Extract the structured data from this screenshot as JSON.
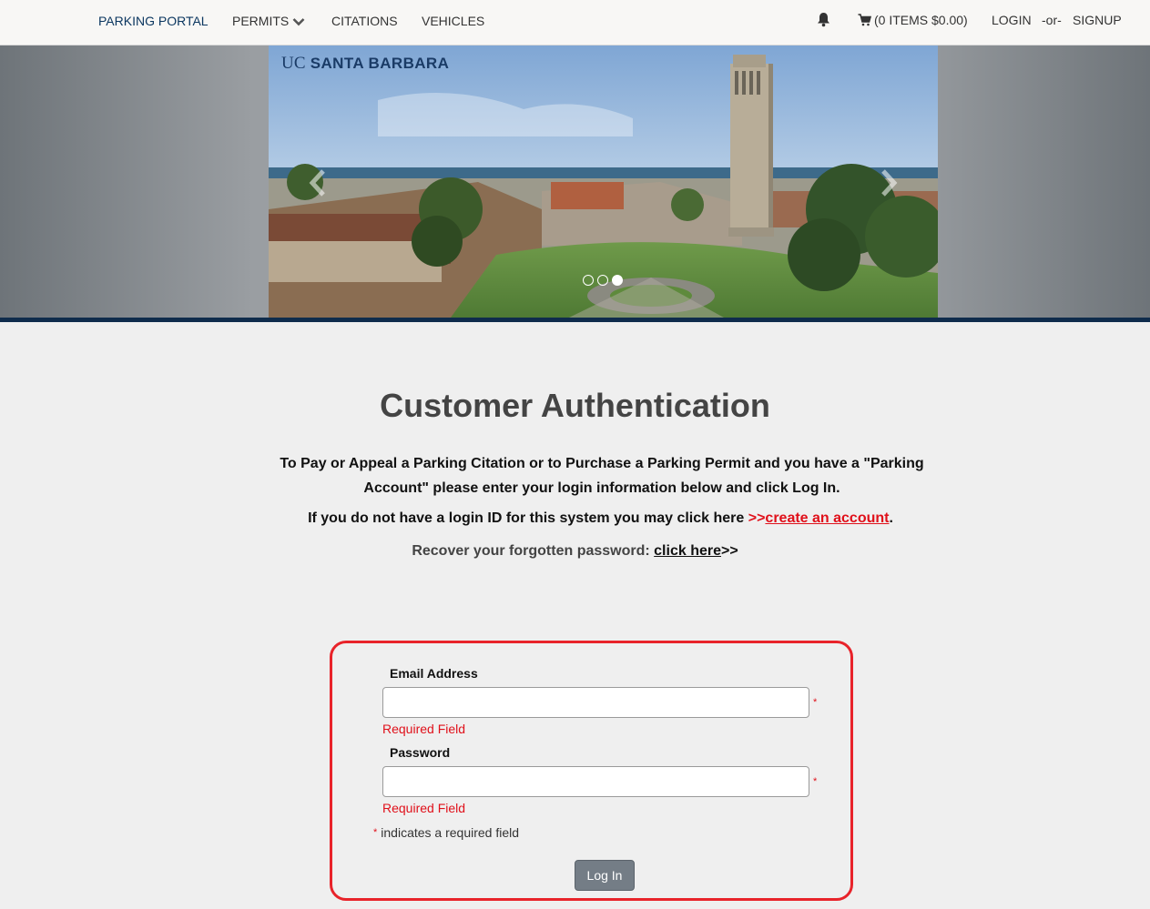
{
  "nav": {
    "brand": "PARKING PORTAL",
    "permits": "PERMITS",
    "citations": "CITATIONS",
    "vehicles": "VEHICLES",
    "cart": "(0 ITEMS $0.00)",
    "login": "LOGIN",
    "or": "-or-",
    "signup": "SIGNUP",
    "icons": [
      "bell-icon",
      "cart-icon",
      "chevron-down-icon"
    ]
  },
  "hero": {
    "logo_prefix": "UC",
    "logo_name": "SANTA BARBARA",
    "slide_count": 3,
    "active_slide": 3
  },
  "page": {
    "title": "Customer Authentication",
    "intro": "To Pay or Appeal a Parking Citation or to Purchase a Parking Permit and you have a \"Parking Account\" please enter your login information below and click Log In.",
    "create_prefix": "If you do not have a login ID for this system you may click here ",
    "create_arrows": ">>",
    "create_link": "create an account",
    "create_suffix": ".",
    "recover_prefix": "Recover your forgotten password: ",
    "recover_link": "click here",
    "recover_suffix": ">>"
  },
  "form": {
    "email_label": "Email Address",
    "email_value": "",
    "password_label": "Password",
    "password_value": "",
    "required_star": "*",
    "required_msg": "Required Field",
    "required_note": "indicates a required field",
    "submit_label": "Log In"
  },
  "colors": {
    "brand_navy": "#0c3760",
    "error_red": "#e0101a",
    "box_border": "#e8232a",
    "button_gray": "#747d86"
  }
}
